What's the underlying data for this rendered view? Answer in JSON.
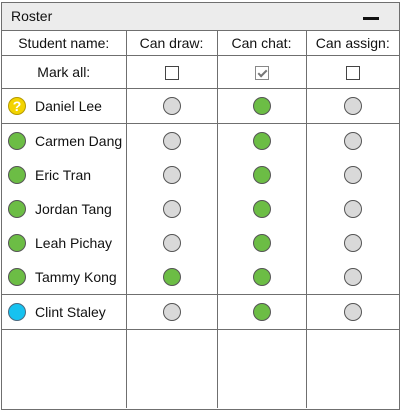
{
  "window": {
    "title": "Roster"
  },
  "columns": {
    "student": "Student name:",
    "draw": "Can draw:",
    "chat": "Can chat:",
    "assign": "Can assign:"
  },
  "mark_all": {
    "label": "Mark all:",
    "draw": false,
    "chat": true,
    "assign": false
  },
  "colors": {
    "online": "#6cbd45",
    "unknown": "#f3d400",
    "self": "#16c2f0",
    "off": "#d9d9d9"
  },
  "students": [
    {
      "name": "Daniel Lee",
      "status_icon": "question-icon",
      "draw": false,
      "chat": true,
      "assign": false
    },
    {
      "name": "Carmen Dang",
      "status_icon": "online-status-icon",
      "draw": false,
      "chat": true,
      "assign": false
    },
    {
      "name": "Eric Tran",
      "status_icon": "online-status-icon",
      "draw": false,
      "chat": true,
      "assign": false
    },
    {
      "name": "Jordan Tang",
      "status_icon": "online-status-icon",
      "draw": false,
      "chat": true,
      "assign": false
    },
    {
      "name": "Leah Pichay",
      "status_icon": "online-status-icon",
      "draw": false,
      "chat": true,
      "assign": false
    },
    {
      "name": "Tammy Kong",
      "status_icon": "online-status-icon",
      "draw": true,
      "chat": true,
      "assign": false
    },
    {
      "name": "Clint Staley",
      "status_icon": "self-status-icon",
      "draw": false,
      "chat": true,
      "assign": false
    }
  ]
}
